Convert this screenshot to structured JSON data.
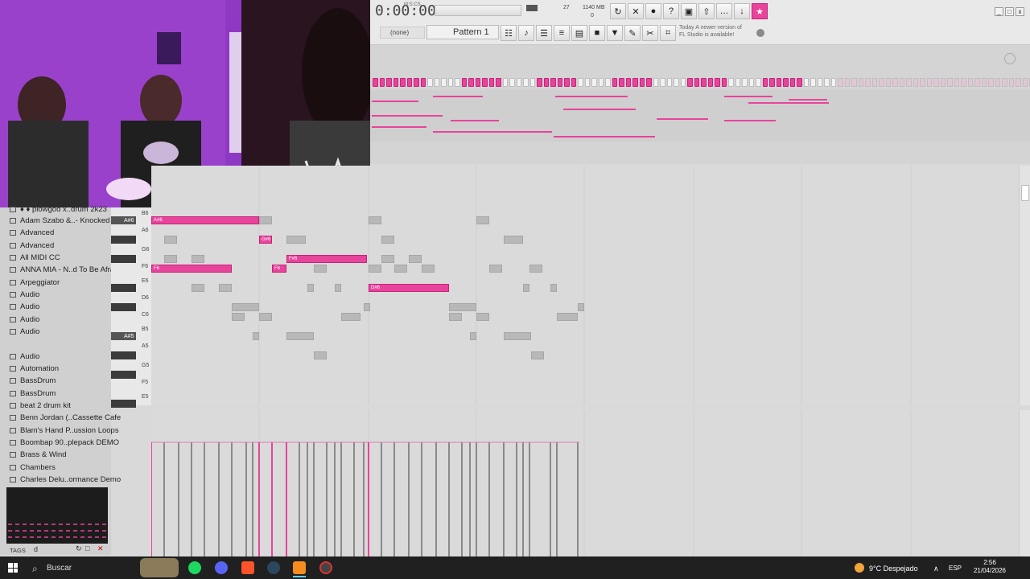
{
  "toolbar": {
    "time": "0:00:00",
    "mscs_label": "M:S:CS",
    "cpu_value": "27",
    "mem_value": "1140 MB",
    "voices_value": "0",
    "none_label": "(none)",
    "pattern_label": "Pattern 1",
    "news_line1": "Today  A newer version of",
    "news_line2": "FL Studio is available!",
    "accent_color": "#e8449c"
  },
  "browser": {
    "items": [
      "♦ ♦ plowgod x..drum 2k23",
      "Adam Szabo &..- Knocked Out",
      "Advanced",
      "Advanced",
      "All MIDI CC",
      "ANNA MIA - N..d To Be Afraid",
      "Arpeggiator",
      "Audio",
      "Audio",
      "Audio",
      "Audio",
      "Audio",
      "Automation",
      "BassDrum",
      "BassDrum",
      "beat 2 drum kit",
      "Benn Jordan (..Cassette Cafe",
      "Blam's Hand P..ussion Loops",
      "Boombap 90..plepack DEMO",
      "Brass & Wind",
      "Chambers",
      "Charles Delu..ormance Demo"
    ],
    "tags_label": "TAGS",
    "tags_value": "d"
  },
  "keys": {
    "labels": [
      "B6",
      "A#6",
      "A6",
      "G6",
      "F6",
      "E6",
      "D6",
      "C6",
      "B5",
      "A#5",
      "A5",
      "G5",
      "F5",
      "E5"
    ]
  },
  "notes": {
    "pink_labels": [
      "A#6",
      "G#6",
      "F#6",
      "F6",
      "F6",
      "D#6"
    ]
  },
  "taskbar": {
    "search_placeholder": "Buscar",
    "weather": "9°C  Despejado",
    "lang": "ESP",
    "time": "2:56",
    "date": "21/04/2026"
  }
}
